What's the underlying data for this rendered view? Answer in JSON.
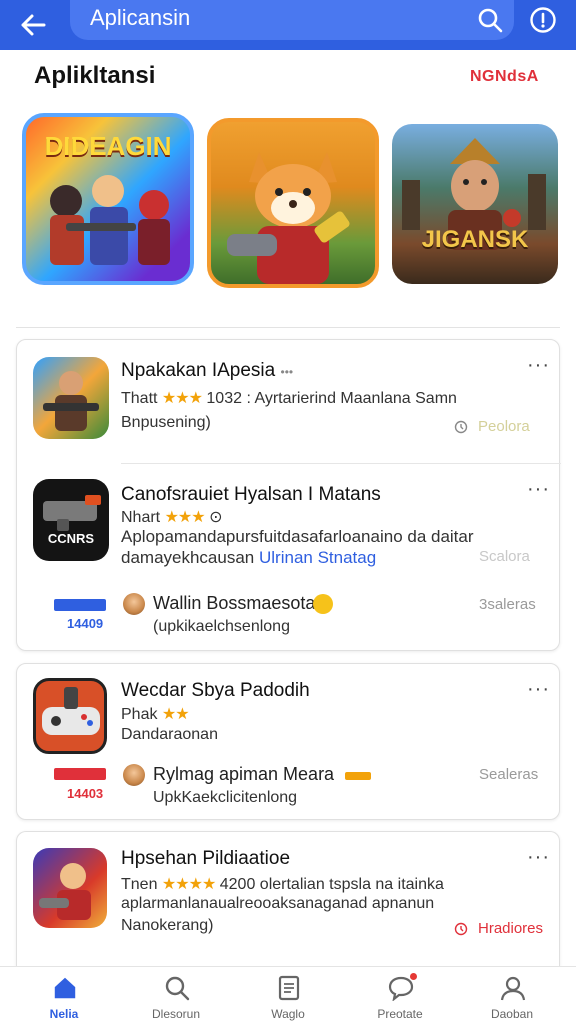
{
  "topbar": {
    "search_text": "Aplicansin",
    "back_icon": "arrow-left-icon",
    "search_icon": "search-icon",
    "info_icon": "info-icon",
    "color": "#2f5fe0"
  },
  "section": {
    "title": "Aplikltansi",
    "link": "NGNdsA"
  },
  "featured": [
    {
      "label": "DIDEAGIN"
    },
    {
      "label": ""
    },
    {
      "label": "JIGANSK"
    }
  ],
  "apps": [
    {
      "name": "Npakakan IApesia",
      "name_suffix": "•••",
      "rating_prefix": "Thatt",
      "stars": "★★★",
      "meta": "1032 : Ayrtarierind Maanlana Samn",
      "sub": "Bnpusening)",
      "action": "Peolora"
    },
    {
      "name": "Canofsrauiet Hyalsan I Matans",
      "rating_prefix": "Nhart",
      "stars": "★★★",
      "meta": "⊙",
      "desc_line1": "Aplopamandapursfuitdasafarloanaino da daitar",
      "desc_line2": "damayekhcausan",
      "desc_link": "Ulrinan Stnatag",
      "action": "Scalora",
      "icon_text": "CCNRS",
      "sub_row": {
        "badge_num": "14409",
        "name": "Wallin Bossmaesotanl",
        "sub": "(upkikaelchsenlong",
        "action": "3saleras"
      }
    },
    {
      "name": "Wecdar Sbya  Padodih",
      "rating_prefix": "Phak",
      "stars": "★★",
      "sub": "Dandaraonan",
      "sub_row": {
        "badge_num": "14403",
        "name": "Rylmag apiman  Meara",
        "sub": "UpkKaekclicitenlong",
        "action": "Sealeras"
      }
    },
    {
      "name": "Hpsehan Pildiaatioe",
      "rating_prefix": "Tnen",
      "stars": "★★★★",
      "meta": "4200 olertalian tspsla na itainka",
      "desc_line1": "aplarmanlanaualreooaksanaganad apnanun",
      "sub": "Nanokerang)",
      "action": "Hradiores"
    }
  ],
  "nav": [
    {
      "label": "Nelia",
      "icon": "home-icon",
      "active": true
    },
    {
      "label": "Dlesorun",
      "icon": "search-icon",
      "active": false
    },
    {
      "label": "Waglo",
      "icon": "document-icon",
      "active": false
    },
    {
      "label": "Preotate",
      "icon": "chat-icon",
      "active": false
    },
    {
      "label": "Daoban",
      "icon": "profile-icon",
      "active": false
    }
  ]
}
